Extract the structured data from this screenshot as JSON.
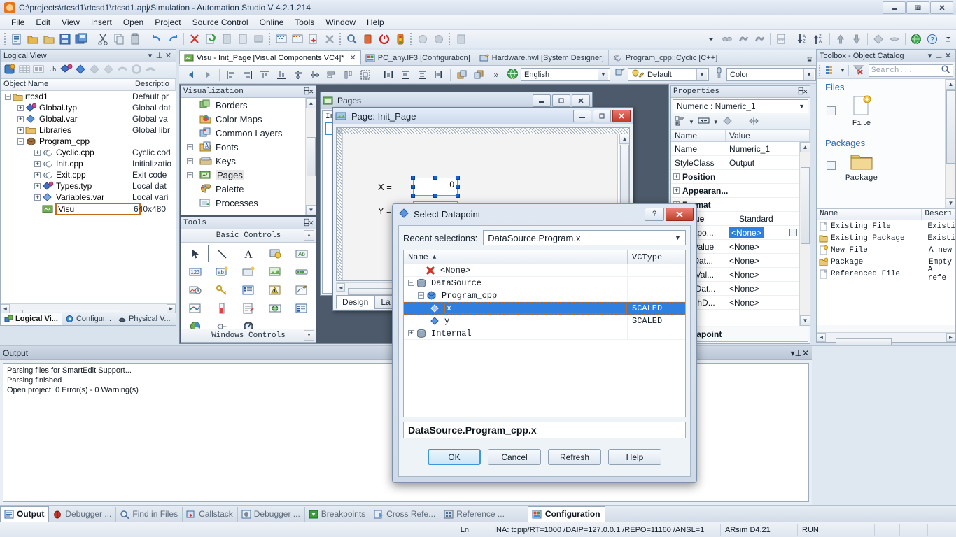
{
  "window": {
    "title": "C:\\projects\\rtcsd1\\rtcsd1\\rtcsd1.apj/Simulation - Automation Studio V 4.2.1.214",
    "app_icon": "automation-studio-icon",
    "minimize": "—",
    "restore": "❐",
    "close": "✕"
  },
  "menu": {
    "items": [
      "File",
      "Edit",
      "View",
      "Insert",
      "Open",
      "Project",
      "Source Control",
      "Online",
      "Tools",
      "Window",
      "Help"
    ]
  },
  "toolbar": {
    "groups": [
      [
        "new-project-icon",
        "open-folder-icon",
        "open-package-icon",
        "save-icon",
        "save-all-icon"
      ],
      [
        "cut-icon",
        "copy-icon",
        "paste-icon"
      ],
      [
        "undo-icon",
        "redo-icon"
      ],
      [
        "delete-icon",
        "rebuild-icon",
        "build-icon",
        "build-config-icon",
        "transfer-icon"
      ],
      [
        "simulation-icon",
        "simulation-all-icon",
        "download-icon",
        "stop-icon"
      ],
      [
        "find-icon",
        "warn-icon",
        "power-icon",
        "traffic-light-icon"
      ],
      [
        "object-icon",
        "object2-icon"
      ],
      [
        "panel-icon"
      ]
    ],
    "right_groups": [
      [
        "watch-icon",
        "debug-step-icon",
        "debug-step2-icon"
      ],
      [
        "watch-doc-icon"
      ],
      [
        "sort-az-icon",
        "sort-za-icon"
      ],
      [
        "up-arrow-icon",
        "down-arrow-icon"
      ],
      [
        "variable-icon",
        "variable2-icon"
      ],
      [
        "globe-icon",
        "help-icon"
      ]
    ]
  },
  "logical_view": {
    "title": "Logical View",
    "title_icons": [
      "chevron-down-icon",
      "pin-icon",
      "close-icon"
    ],
    "toolbar_icons": [
      "add-object-icon",
      "table-icon",
      "properties-icon",
      "header-icon",
      "datatype-icon",
      "variable-icon",
      "import-icon",
      "export-icon",
      "ref1-icon",
      "ref2-icon",
      "ref3-icon"
    ],
    "columns": [
      "Object Name",
      "Descriptio"
    ],
    "rows": [
      {
        "indent": 0,
        "expander": "-",
        "icon": "folder-icon",
        "label": "rtcsd1",
        "desc": "Default pr"
      },
      {
        "indent": 1,
        "expander": "+",
        "icon": "datatype-icon",
        "label": "Global.typ",
        "desc": "Global dat"
      },
      {
        "indent": 1,
        "expander": "+",
        "icon": "variable-icon",
        "label": "Global.var",
        "desc": "Global va"
      },
      {
        "indent": 1,
        "expander": "+",
        "icon": "folder-icon",
        "label": "Libraries",
        "desc": "Global libr"
      },
      {
        "indent": 1,
        "expander": "-",
        "icon": "package-icon",
        "label": "Program_cpp",
        "desc": ""
      },
      {
        "indent": 2,
        "expander": "+",
        "icon": "cpp-icon",
        "label": "Cyclic.cpp",
        "desc": "Cyclic cod"
      },
      {
        "indent": 2,
        "expander": "+",
        "icon": "cpp-icon",
        "label": "Init.cpp",
        "desc": "Initializatio"
      },
      {
        "indent": 2,
        "expander": "+",
        "icon": "cpp-icon",
        "label": "Exit.cpp",
        "desc": "Exit code"
      },
      {
        "indent": 2,
        "expander": "+",
        "icon": "datatype-icon",
        "label": "Types.typ",
        "desc": "Local dat"
      },
      {
        "indent": 2,
        "expander": "+",
        "icon": "variable-icon",
        "label": "Variables.var",
        "desc": "Local vari"
      },
      {
        "indent": 2,
        "expander": "",
        "icon": "visu-icon",
        "label": "Visu",
        "desc": "640x480",
        "editing": true
      }
    ],
    "tabs": [
      {
        "label": "Logical Vi...",
        "icon": "logical-view-icon",
        "active": true
      },
      {
        "label": "Configur...",
        "icon": "config-icon",
        "active": false
      },
      {
        "label": "Physical V...",
        "icon": "physical-view-icon",
        "active": false
      }
    ]
  },
  "visualization": {
    "title": "Visualization",
    "title_icons": [
      "float-icon",
      "close-icon"
    ],
    "items": [
      {
        "expander": "",
        "icon": "borders-icon",
        "label": "Borders"
      },
      {
        "expander": "",
        "icon": "colormaps-icon",
        "label": "Color Maps"
      },
      {
        "expander": "",
        "icon": "commonlayers-icon",
        "label": "Common Layers"
      },
      {
        "expander": "+",
        "icon": "fonts-icon",
        "label": "Fonts"
      },
      {
        "expander": "+",
        "icon": "keys-icon",
        "label": "Keys"
      },
      {
        "expander": "+",
        "icon": "pages-icon",
        "label": "Pages",
        "selected": true
      },
      {
        "expander": "",
        "icon": "palette-icon",
        "label": "Palette"
      },
      {
        "expander": "",
        "icon": "processes-icon",
        "label": "Processes"
      }
    ]
  },
  "tools": {
    "title": "Tools",
    "title_icons": [
      "float-icon",
      "close-icon"
    ],
    "section_top": "Basic Controls",
    "section_bottom": "Windows Controls",
    "items": [
      {
        "icon": "pointer-icon",
        "selected": true
      },
      {
        "icon": "line-icon"
      },
      {
        "icon": "text-icon"
      },
      {
        "icon": "shape-icon"
      },
      {
        "icon": "label-icon"
      },
      {
        "icon": "numeric-icon"
      },
      {
        "icon": "string-icon"
      },
      {
        "icon": "button-icon"
      },
      {
        "icon": "bitmap-icon"
      },
      {
        "icon": "bargraph-icon"
      },
      {
        "icon": "datetime-icon"
      },
      {
        "icon": "key-icon"
      },
      {
        "icon": "listbox-icon"
      },
      {
        "icon": "alarm-icon"
      },
      {
        "icon": "pen-icon"
      },
      {
        "icon": "trend-icon"
      },
      {
        "icon": "slider-icon"
      },
      {
        "icon": "note-icon"
      },
      {
        "icon": "globe-ctrl-icon"
      },
      {
        "icon": "table-ctrl-icon"
      },
      {
        "icon": "pie-icon"
      },
      {
        "icon": "hotspot-icon"
      },
      {
        "icon": "gauge-icon"
      }
    ]
  },
  "editor": {
    "tabs": [
      {
        "label": "Visu - Init_Page [Visual Components VC4]*",
        "icon": "visu-icon",
        "active": true,
        "closable": true
      },
      {
        "label": "PC_any.IF3 [Configuration]",
        "icon": "config-icon",
        "active": false
      },
      {
        "label": "Hardware.hwl [System Designer]",
        "icon": "hardware-icon",
        "active": false
      },
      {
        "label": "Program_cpp::Cyclic [C++]",
        "icon": "cpp-icon",
        "active": false
      }
    ],
    "overflow_icon": "tab-overflow-icon",
    "toolbar_icons": [
      "nav-back-icon",
      "nav-forward-icon",
      "align-left-icon",
      "align-right-icon",
      "align-top-icon",
      "align-bottom-icon",
      "center-horizontal-icon",
      "center-vertical-icon",
      "size-width-icon",
      "size-height-icon",
      "size-both-icon",
      "space-horizontal-icon",
      "space-vertical-icon",
      "space-equal-icon",
      "make-same-width-icon",
      "bring-front-icon",
      "send-back-icon"
    ],
    "overflow_chevron": "»",
    "language_combo": {
      "icon": "globe-icon",
      "value": "English"
    },
    "style_combo": {
      "icon": "style-icon",
      "value": "Default"
    },
    "color_combo": {
      "icon": "color-icon",
      "value": "Color"
    }
  },
  "pages_window": {
    "title": "Pages",
    "icon": "pages-icon",
    "buttons": [
      "minimize",
      "restore",
      "close"
    ],
    "list_header": "Ind"
  },
  "init_page_window": {
    "title": "Page: Init_Page",
    "icon": "page-icon",
    "buttons": [
      "minimize",
      "restore",
      "close"
    ],
    "labels": {
      "x": "X =",
      "y": "Y ="
    },
    "numeric_value": "0",
    "tabs": [
      {
        "label": "Design",
        "active": true
      },
      {
        "label": "La",
        "active": false
      }
    ]
  },
  "properties": {
    "title": "Properties",
    "title_icons": [
      "float-icon",
      "close-icon"
    ],
    "object_selector": "Numeric : Numeric_1",
    "toolbar_icons": [
      "categorize-icon",
      "alphabetize-icon",
      "datapoint-icon",
      "layout-icon"
    ],
    "columns": [
      "Name",
      "Value"
    ],
    "rows": [
      {
        "name": "Name",
        "value": "Numeric_1",
        "group": false,
        "expander": ""
      },
      {
        "name": "StyleClass",
        "value": "Output",
        "group": false,
        "expander": ""
      },
      {
        "name": "Position",
        "value": "",
        "group": true,
        "expander": "+"
      },
      {
        "name": "Appearan...",
        "value": "",
        "group": true,
        "expander": "+"
      },
      {
        "name": "Format",
        "value": "",
        "group": true,
        "expander": "+"
      },
      {
        "name": "Value",
        "value": "Standard",
        "group": true,
        "expander": "+"
      },
      {
        "name": "Datapo...",
        "value": "<None>",
        "group": false,
        "expander": "",
        "selected": true,
        "browse": true
      },
      {
        "name": "MinValue",
        "value": "<None>",
        "group": false,
        "expander": ""
      },
      {
        "name": "MinDat...",
        "value": "<None>",
        "group": false,
        "expander": ""
      },
      {
        "name": "MaxVal...",
        "value": "<None>",
        "group": false,
        "expander": ""
      },
      {
        "name": "MaxDat...",
        "value": "<None>",
        "group": false,
        "expander": ""
      },
      {
        "name": "TeachD...",
        "value": "<None>",
        "group": false,
        "expander": ""
      }
    ],
    "status_text": "e.Datapoint"
  },
  "toolbox": {
    "title": "Toolbox - Object Catalog",
    "title_icons": [
      "chevron-down-icon",
      "pin-icon",
      "close-icon"
    ],
    "view_icon": "list-view-icon",
    "filter_icon": "clear-filter-icon",
    "search_placeholder": "Search...",
    "search_icon": "search-icon",
    "groups": [
      {
        "label": "Files",
        "items": [
          {
            "label": "File",
            "icon": "new-file-icon"
          }
        ]
      },
      {
        "label": "Packages",
        "items": [
          {
            "label": "Package",
            "icon": "folder-icon"
          }
        ]
      }
    ],
    "list_columns": [
      "Name",
      "Descri"
    ],
    "list_rows": [
      {
        "icon": "file-icon",
        "name": "Existing File",
        "desc": "Existi"
      },
      {
        "icon": "folder-icon",
        "name": "Existing Package",
        "desc": "Existi"
      },
      {
        "icon": "new-file-icon",
        "name": "New File",
        "desc": "A new"
      },
      {
        "icon": "new-pkg-icon",
        "name": "Package",
        "desc": "Empty"
      },
      {
        "icon": "file-icon",
        "name": "Referenced File",
        "desc": "A refe"
      }
    ]
  },
  "output": {
    "title": "Output",
    "lines": [
      "Parsing files for SmartEdit Support...",
      "Parsing finished",
      "Open project: 0 Error(s) - 0 Warning(s)"
    ]
  },
  "bottom_tabs": {
    "left": [
      {
        "label": "Output",
        "icon": "output-icon",
        "active": true
      },
      {
        "label": "Debugger ...",
        "icon": "debugger-icon",
        "active": false
      },
      {
        "label": "Find in Files",
        "icon": "find-icon",
        "active": false
      },
      {
        "label": "Callstack",
        "icon": "callstack-icon",
        "active": false
      },
      {
        "label": "Debugger ...",
        "icon": "debugger2-icon",
        "active": false
      },
      {
        "label": "Breakpoints",
        "icon": "breakpoint-icon",
        "active": false
      },
      {
        "label": "Cross Refe...",
        "icon": "crossref-icon",
        "active": false
      },
      {
        "label": "Reference ...",
        "icon": "reference-icon",
        "active": false
      }
    ],
    "right": [
      {
        "label": "Configuration",
        "icon": "config-icon",
        "active": true
      }
    ]
  },
  "statusbar": {
    "line_label": "Ln",
    "cells": [
      "INA: tcpip/RT=1000 /DAIP=127.0.0.1 /REPO=11160 /ANSL=1",
      "ARsim  D4.21",
      "RUN"
    ]
  },
  "dialog": {
    "title": "Select Datapoint",
    "icon": "datapoint-icon",
    "help_button": "?",
    "close_button": "✕",
    "recent_label": "Recent selections:",
    "recent_value": "DataSource.Program.x",
    "columns": [
      "Name",
      "VCType"
    ],
    "sort_indicator": "▲",
    "rows": [
      {
        "indent": 1,
        "expander": "",
        "icon": "none-x-icon",
        "name": "<None>",
        "vctype": ""
      },
      {
        "indent": 0,
        "expander": "-",
        "icon": "datasource-icon",
        "name": "DataSource",
        "vctype": ""
      },
      {
        "indent": 1,
        "expander": "-",
        "icon": "program-icon",
        "name": "Program_cpp",
        "vctype": ""
      },
      {
        "indent": 2,
        "expander": "",
        "icon": "variable-icon",
        "name": "x",
        "vctype": "SCALED",
        "selected": true
      },
      {
        "indent": 2,
        "expander": "",
        "icon": "variable-icon",
        "name": "y",
        "vctype": "SCALED"
      },
      {
        "indent": 0,
        "expander": "+",
        "icon": "datasource-icon",
        "name": "Internal",
        "vctype": ""
      }
    ],
    "selected_path": "DataSource.Program_cpp.x",
    "buttons": [
      {
        "label": "OK",
        "default": true
      },
      {
        "label": "Cancel",
        "default": false
      },
      {
        "label": "Refresh",
        "default": false
      },
      {
        "label": "Help",
        "default": false
      }
    ]
  },
  "colors": {
    "selection_blue": "#2f7fe0",
    "accent_orange": "#c06a1a",
    "close_red": "#c23e2d",
    "group_blue": "#2d6bb5"
  }
}
